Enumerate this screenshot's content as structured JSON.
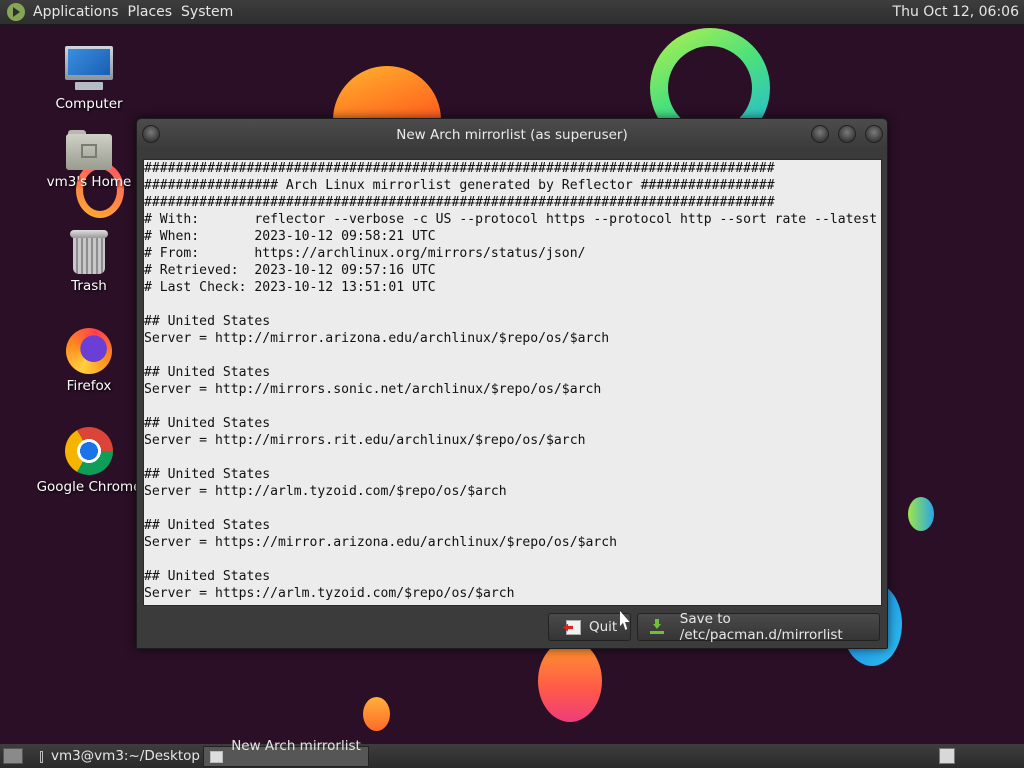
{
  "top_panel": {
    "menus": [
      "Applications",
      "Places",
      "System"
    ],
    "clock": "Thu Oct 12, 06:06"
  },
  "desktop": {
    "icons": [
      {
        "label": "Computer",
        "icon": "computer-icon"
      },
      {
        "label": "vm3's Home",
        "icon": "home-folder-icon"
      },
      {
        "label": "Trash",
        "icon": "trash-icon"
      },
      {
        "label": "Firefox",
        "icon": "firefox-icon"
      },
      {
        "label": "Google Chrome",
        "icon": "chrome-icon"
      }
    ]
  },
  "window": {
    "title": "New Arch mirrorlist (as superuser)",
    "lines": [
      "################################################################################",
      "################# Arch Linux mirrorlist generated by Reflector #################",
      "################################################################################",
      "# With:       reflector --verbose -c US --protocol https --protocol http --sort rate --latest",
      "# When:       2023-10-12 09:58:21 UTC",
      "# From:       https://archlinux.org/mirrors/status/json/",
      "# Retrieved:  2023-10-12 09:57:16 UTC",
      "# Last Check: 2023-10-12 13:51:01 UTC",
      "",
      "## United States",
      "Server = http://mirror.arizona.edu/archlinux/$repo/os/$arch",
      "",
      "## United States",
      "Server = http://mirrors.sonic.net/archlinux/$repo/os/$arch",
      "",
      "## United States",
      "Server = http://mirrors.rit.edu/archlinux/$repo/os/$arch",
      "",
      "## United States",
      "Server = http://arlm.tyzoid.com/$repo/os/$arch",
      "",
      "## United States",
      "Server = https://mirror.arizona.edu/archlinux/$repo/os/$arch",
      "",
      "## United States",
      "Server = https://arlm.tyzoid.com/$repo/os/$arch"
    ],
    "quit_label": "Quit",
    "save_label": "Save to /etc/pacman.d/mirrorlist"
  },
  "taskbar": {
    "tasks": [
      {
        "label": "vm3@vm3:~/Desktop",
        "icon": "terminal-icon",
        "active": false
      },
      {
        "label": "New Arch mirrorlist ...",
        "icon": "window-icon",
        "active": true
      }
    ]
  },
  "colors": {
    "desktop_bg": "#2a0f26",
    "panel": "#2e2e2e",
    "editor_bg": "#ececec"
  }
}
